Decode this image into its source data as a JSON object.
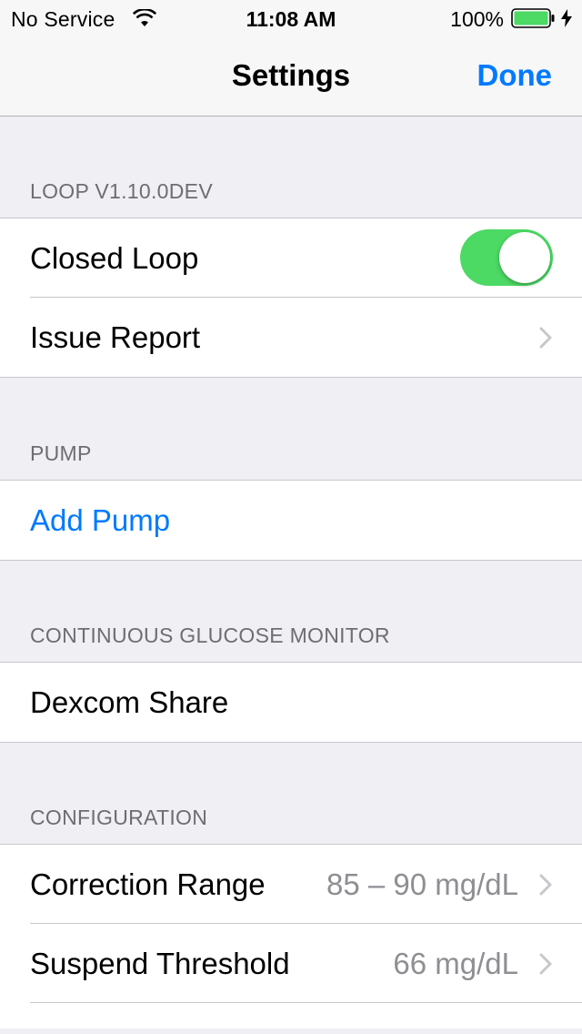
{
  "status_bar": {
    "carrier": "No Service",
    "time": "11:08 AM",
    "battery_percent": "100%",
    "icons": [
      "wifi-icon",
      "battery-icon",
      "charging-bolt-icon"
    ],
    "battery_color": "#4cd964"
  },
  "nav": {
    "title": "Settings",
    "done_label": "Done",
    "accent_color": "#007aff"
  },
  "sections": {
    "loop": {
      "header": "LOOP V1.10.0DEV",
      "closed_loop_label": "Closed Loop",
      "closed_loop_on": true,
      "issue_report_label": "Issue Report"
    },
    "pump": {
      "header": "PUMP",
      "add_pump_label": "Add Pump"
    },
    "cgm": {
      "header": "CONTINUOUS GLUCOSE MONITOR",
      "dexcom_label": "Dexcom Share"
    },
    "configuration": {
      "header": "CONFIGURATION",
      "correction_range_label": "Correction Range",
      "correction_range_value": "85 – 90 mg/dL",
      "suspend_threshold_label": "Suspend Threshold",
      "suspend_threshold_value": "66 mg/dL"
    }
  }
}
